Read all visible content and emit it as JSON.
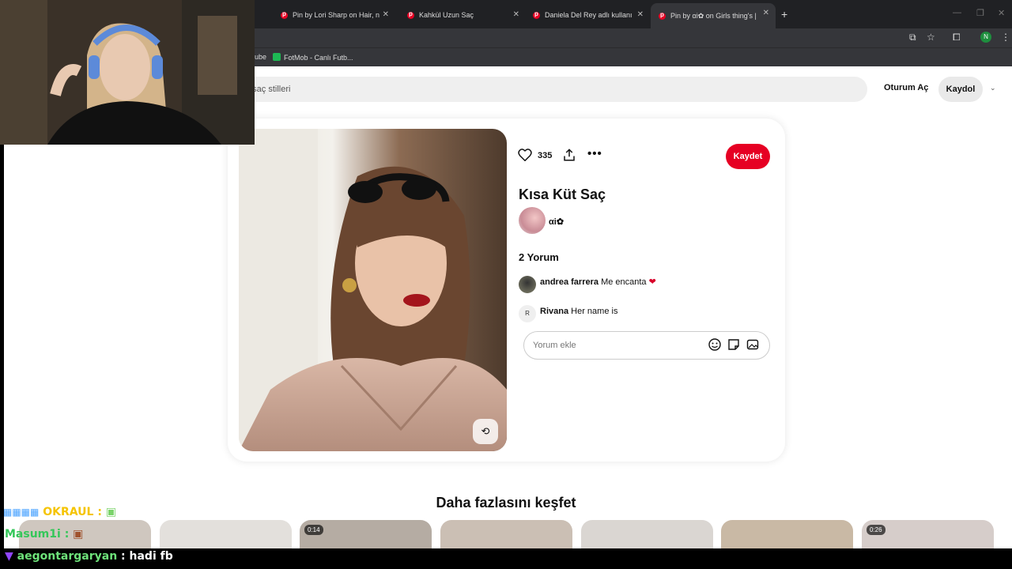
{
  "browser": {
    "tabs": [
      {
        "title": "Pin by Lori Sharp on Hair, nails,",
        "active": false
      },
      {
        "title": "Kahkül Uzun Saç",
        "active": false
      },
      {
        "title": "Daniela Del Rey adlı kullanıcının",
        "active": false
      },
      {
        "title": "Pin by αi✿ on Girls thing's | Bar",
        "active": true
      }
    ],
    "new_tab": "+",
    "profile_initial": "N",
    "bookmarks": [
      "ube",
      "FotMob - Canlı Futb..."
    ]
  },
  "header": {
    "search_text": "a saç stilleri",
    "login_label": "Oturum Aç",
    "signup_label": "Kaydol"
  },
  "pin": {
    "like_count": "335",
    "save_label": "Kaydet",
    "title": "Kısa Küt Saç",
    "author": "αi✿",
    "comments_heading": "2 Yorum",
    "comments": [
      {
        "user": "andrea farrera",
        "text": "Me encanta",
        "avatar": "",
        "emoji": "❤"
      },
      {
        "user": "Rivana",
        "text": "Her name is",
        "avatar": "R",
        "emoji": ""
      }
    ],
    "comment_placeholder": "Yorum ekle"
  },
  "explore": {
    "heading": "Daha fazlasını keşfet",
    "thumbs": [
      {
        "duration": ""
      },
      {
        "duration": ""
      },
      {
        "duration": "0:14"
      },
      {
        "duration": ""
      },
      {
        "duration": ""
      },
      {
        "duration": ""
      },
      {
        "duration": "0:26"
      }
    ]
  },
  "stream_chat": [
    {
      "user": "OKRAUL",
      "message": ":",
      "color": "#f5c400"
    },
    {
      "user": "Masum1i",
      "message": ":",
      "color": "#34c759"
    },
    {
      "user": "aegontargaryan",
      "message": ": hadi fb",
      "color": "#6ee27a"
    }
  ],
  "colors": {
    "accent": "#e60023",
    "chrome_bg": "#202124",
    "toolbar_bg": "#35363a"
  }
}
